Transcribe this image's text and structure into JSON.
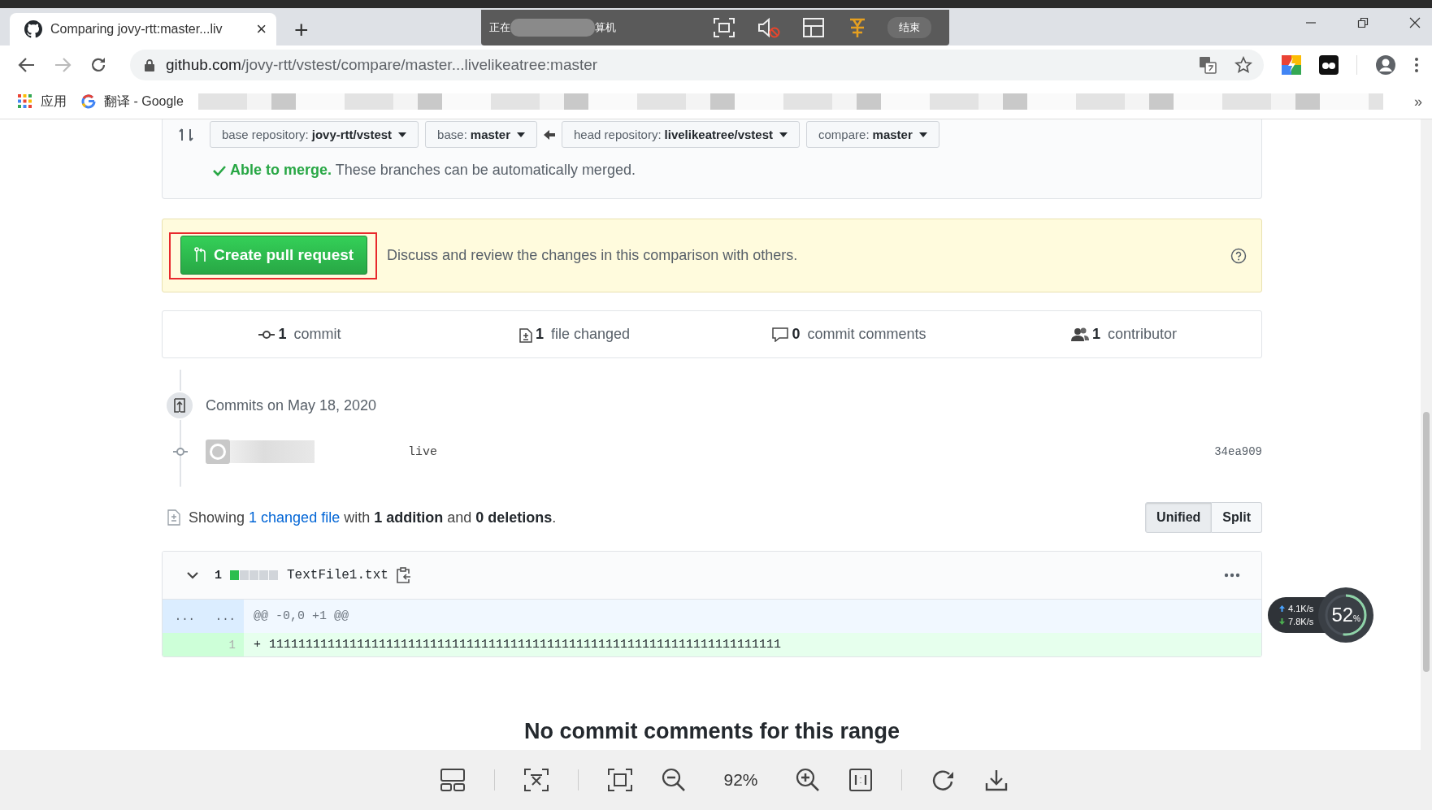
{
  "browser": {
    "tab": {
      "title": "Comparing jovy-rtt:master...liv",
      "close": "×"
    },
    "new_tab": "+",
    "url": {
      "host": "github.com",
      "path": "/jovy-rtt/vstest/compare/master...livelikeatree:master"
    },
    "bookmarks": [
      {
        "label": "应用"
      },
      {
        "label": "翻译 - Google"
      }
    ],
    "more": "»"
  },
  "share_overlay": {
    "prefix": "正在",
    "suffix": "算机",
    "end_button": "结束"
  },
  "compare": {
    "selectors": [
      {
        "label": "base repository:",
        "value": "jovy-rtt/vstest"
      },
      {
        "label": "base:",
        "value": "master"
      },
      {
        "label": "head repository:",
        "value": "livelikeatree/vstest"
      },
      {
        "label": "compare:",
        "value": "master"
      }
    ],
    "merge_status": {
      "strong": "Able to merge.",
      "text": "These branches can be automatically merged."
    }
  },
  "create_pr": {
    "button": "Create pull request",
    "text": "Discuss and review the changes in this comparison with others."
  },
  "stats": [
    {
      "kind": "commit",
      "count": "1",
      "label": "commit"
    },
    {
      "kind": "file",
      "count": "1",
      "label": "file changed"
    },
    {
      "kind": "comment",
      "count": "0",
      "label": "commit comments"
    },
    {
      "kind": "contributor",
      "count": "1",
      "label": "contributor"
    }
  ],
  "commit_group": {
    "date": "Commits on May 18, 2020",
    "commits": [
      {
        "message": "live",
        "sha": "34ea909"
      }
    ]
  },
  "summary": {
    "prefix": "Showing",
    "link": "1 changed file",
    "rest": "with **1 addition** and **0 deletions**."
  },
  "view_toggle": [
    {
      "label": "Unified",
      "selected": true
    },
    {
      "label": "Split",
      "selected": false
    }
  ],
  "file": {
    "expanded": true,
    "count": "1",
    "name": "TextFile1.txt",
    "hunk_markers": [
      "...",
      "..."
    ],
    "hunk": "@@ -0,0 +1 @@",
    "lines": [
      {
        "new_no": "1",
        "sign": "+",
        "code": "1111111111111111111111111111111111111111111111111111111111111111111111"
      }
    ]
  },
  "no_comments": "No commit comments for this range",
  "viewer": {
    "zoom": "92%"
  },
  "net_widget": {
    "up": "4.1K/s",
    "down": "7.8K/s",
    "value": "52",
    "unit": "%",
    "level": 0.52
  }
}
